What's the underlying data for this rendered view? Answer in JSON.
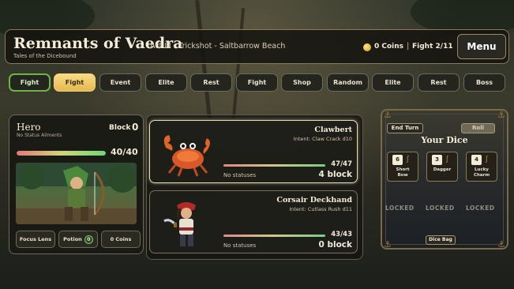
{
  "header": {
    "title": "Remnants of Vaedra",
    "subtitle": "Tales of the Dicebound",
    "act_label": "Act III - Trickshot - Saltbarrow Beach",
    "coins_label": "0 Coins",
    "separator": "|",
    "fight_label": "Fight 2/11",
    "menu_label": "Menu"
  },
  "map_nodes": [
    {
      "label": "Fight",
      "state": "done"
    },
    {
      "label": "Fight",
      "state": "current"
    },
    {
      "label": "Event",
      "state": "upcoming"
    },
    {
      "label": "Elite",
      "state": "upcoming"
    },
    {
      "label": "Rest",
      "state": "upcoming"
    },
    {
      "label": "Fight",
      "state": "upcoming"
    },
    {
      "label": "Shop",
      "state": "upcoming"
    },
    {
      "label": "Random",
      "state": "upcoming"
    },
    {
      "label": "Elite",
      "state": "upcoming"
    },
    {
      "label": "Rest",
      "state": "upcoming"
    },
    {
      "label": "Boss",
      "state": "upcoming"
    }
  ],
  "hero": {
    "name": "Hero",
    "status": "No Status Ailments",
    "block_label": "Block",
    "block_value": "0",
    "hp_text": "40/40",
    "hp_fraction": 1.0,
    "buttons": {
      "focus_lens": "Focus Lens",
      "potion": "Potion",
      "potion_count": "0",
      "coins": "0 Coins"
    }
  },
  "enemies": [
    {
      "name": "Clawbert",
      "intent": "Intent: Claw Crack d10",
      "hp_text": "47/47",
      "hp_fraction": 1.0,
      "statuses": "No statuses",
      "block": "4 block",
      "selected": true
    },
    {
      "name": "Corsair Deckhand",
      "intent": "Intent: Cutlass Rush d11",
      "hp_text": "43/43",
      "hp_fraction": 1.0,
      "statuses": "No statuses",
      "block": "0 block",
      "selected": false
    }
  ],
  "dice": {
    "end_turn_label": "End Turn",
    "roll_label": "Roll",
    "title": "Your Dice",
    "slots": [
      {
        "face": "6",
        "line1": "Short",
        "line2": "Bow"
      },
      {
        "face": "3",
        "line1": "Dagger",
        "line2": ""
      },
      {
        "face": "4",
        "line1": "Lucky",
        "line2": "Charm"
      }
    ],
    "locked_label": "LOCKED",
    "bag_label": "Dice Bag"
  },
  "colors": {
    "accent_gold": "#e6b94e",
    "done_green": "#6bb542"
  }
}
